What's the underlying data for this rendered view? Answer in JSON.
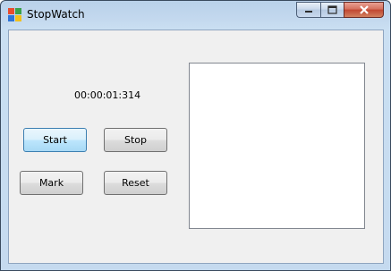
{
  "window": {
    "title": "StopWatch"
  },
  "titlebar": {
    "icons": {
      "app": "app-icon",
      "minimize": "minimize-icon",
      "maximize": "maximize-icon",
      "close": "close-icon"
    }
  },
  "display": {
    "time": "00:00:01:314"
  },
  "buttons": {
    "start": "Start",
    "stop": "Stop",
    "mark": "Mark",
    "reset": "Reset"
  },
  "marks_list": {
    "items": []
  }
}
